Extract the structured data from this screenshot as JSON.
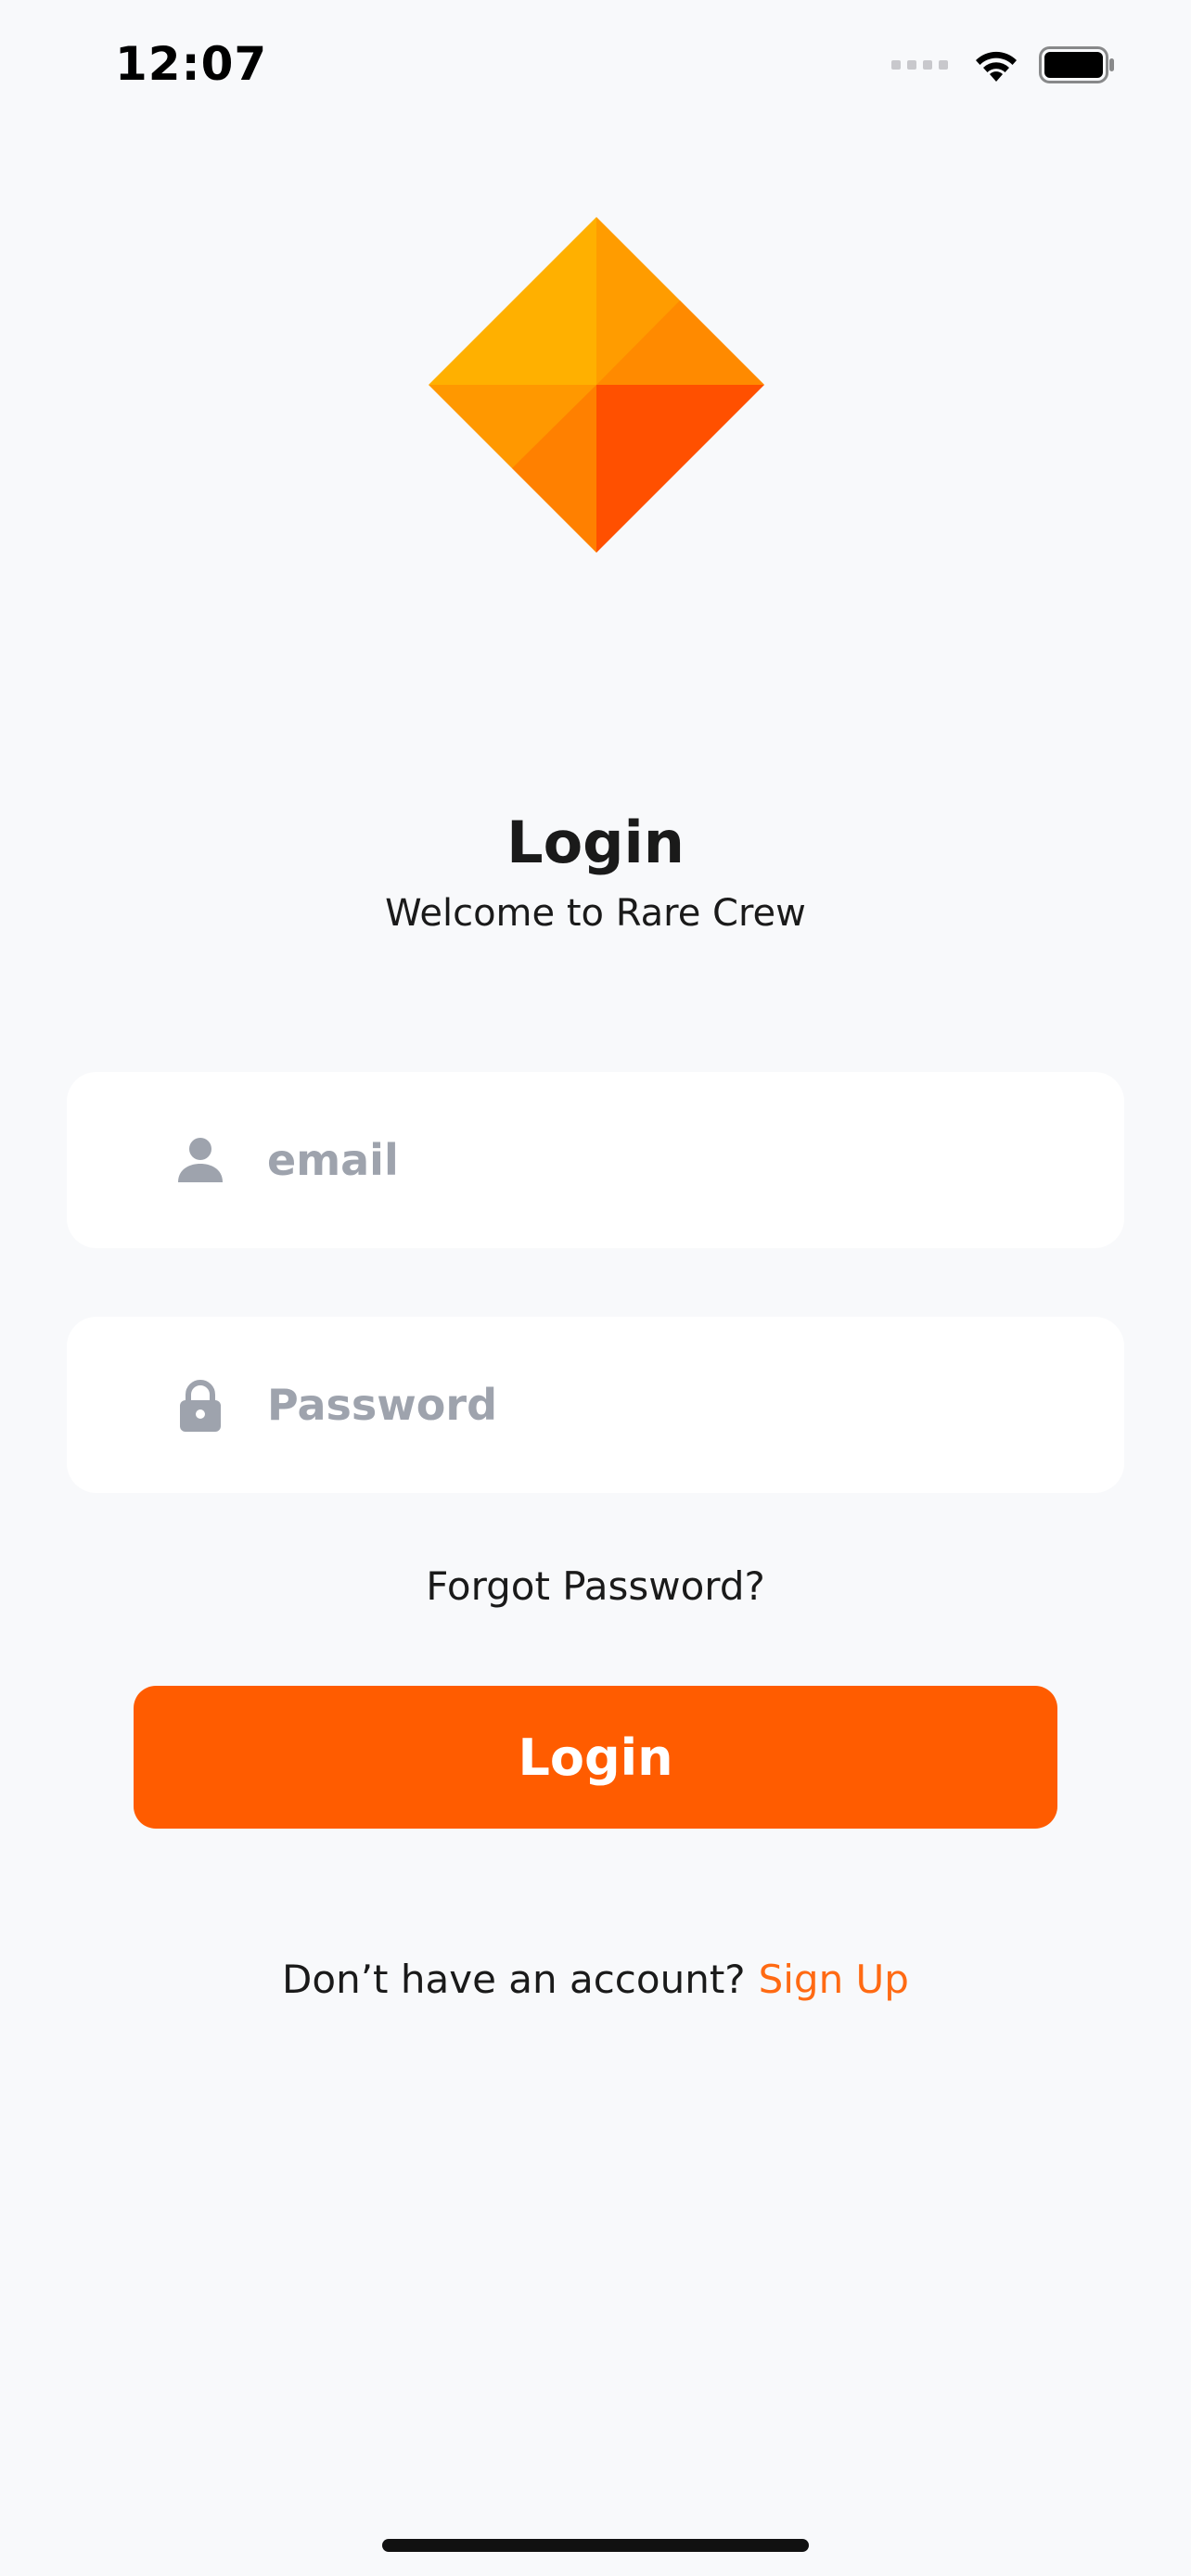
{
  "status_bar": {
    "time": "12:07",
    "icons": [
      "cellular-signal-icon",
      "wifi-icon",
      "battery-icon"
    ]
  },
  "logo": {
    "icon": "rare-crew-diamond-logo",
    "colors": [
      "#FFB000",
      "#FF9800",
      "#FF8000",
      "#FF5000"
    ]
  },
  "header": {
    "title": "Login",
    "subtitle": "Welcome to Rare Crew"
  },
  "form": {
    "email": {
      "value": "",
      "placeholder": "email",
      "icon": "user-icon"
    },
    "password": {
      "value": "",
      "placeholder": "Password",
      "icon": "lock-icon"
    },
    "forgot_label": "Forgot Password?",
    "login_label": "Login"
  },
  "signup": {
    "prompt": "Don’t have an account?",
    "link_label": "Sign Up"
  },
  "colors": {
    "accent": "#FF5C00",
    "link": "#FF6A13",
    "background": "#F8F9FB",
    "placeholder": "#9EA3AD"
  }
}
